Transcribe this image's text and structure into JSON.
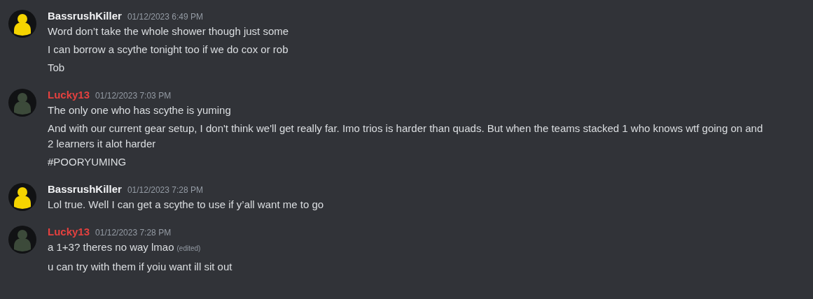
{
  "messages": [
    {
      "author": "BassrushKiller",
      "color": "#f2f3f5",
      "avatar": {
        "color": "#f5d400"
      },
      "timestamp": "01/12/2023 6:49 PM",
      "lines": [
        {
          "text": "Word don’t take the whole shower though just some"
        },
        {
          "text": "I can borrow a scythe tonight too if we do cox or rob"
        },
        {
          "text": "Tob"
        }
      ]
    },
    {
      "author": "Lucky13",
      "color": "#e5413f",
      "avatar": {
        "color": "#3c4a3a"
      },
      "timestamp": "01/12/2023 7:03 PM",
      "lines": [
        {
          "text": "The only one who has scythe is yuming"
        },
        {
          "text": "And with our current gear setup, I don't think we'll get really far. Imo trios is harder than quads. But when the teams stacked 1 who knows wtf going on and 2 learners it alot harder"
        },
        {
          "text": "#POORYUMING"
        }
      ]
    },
    {
      "author": "BassrushKiller",
      "color": "#f2f3f5",
      "avatar": {
        "color": "#f5d400"
      },
      "timestamp": "01/12/2023 7:28 PM",
      "lines": [
        {
          "text": "Lol true. Well I can get a scythe to use if y’all want me to go"
        }
      ]
    },
    {
      "author": "Lucky13",
      "color": "#e5413f",
      "avatar": {
        "color": "#3c4a3a"
      },
      "timestamp": "01/12/2023 7:28 PM",
      "lines": [
        {
          "text": "a 1+3? theres no way lmao",
          "edited": "(edited)"
        },
        {
          "text": "u can try with them if yoiu want ill sit out"
        }
      ]
    }
  ]
}
